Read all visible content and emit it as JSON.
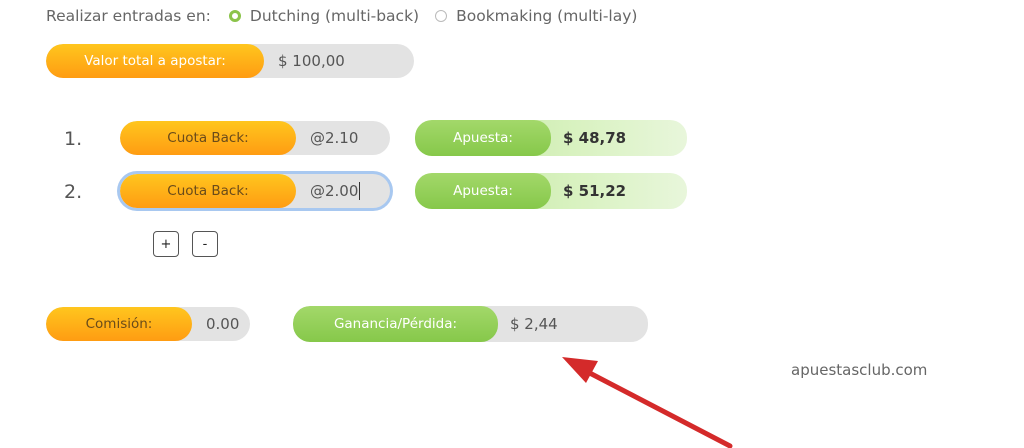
{
  "mode": {
    "label": "Realizar entradas en:",
    "options": [
      {
        "label": "Dutching (multi-back)",
        "selected": true
      },
      {
        "label": "Bookmaking (multi-lay)",
        "selected": false
      }
    ]
  },
  "total": {
    "label": "Valor total a apostar:",
    "value": "$ 100,00"
  },
  "rows": [
    {
      "num": "1.",
      "odds_label": "Cuota Back:",
      "odds_value": "@2.10",
      "stake_label": "Apuesta:",
      "stake_value": "$ 48,78"
    },
    {
      "num": "2.",
      "odds_label": "Cuota Back:",
      "odds_value": "@2.00",
      "stake_label": "Apuesta:",
      "stake_value": "$ 51,22"
    }
  ],
  "buttons": {
    "add": "+",
    "remove": "-"
  },
  "commission": {
    "label": "Comisión:",
    "value": "0.00"
  },
  "profit": {
    "label": "Ganancia/Pérdida:",
    "value": "$ 2,44"
  },
  "brand": "apuestasclub.com",
  "colors": {
    "orange": "#ffb11a",
    "green": "#8fce55",
    "arrow": "#d42a2a"
  }
}
